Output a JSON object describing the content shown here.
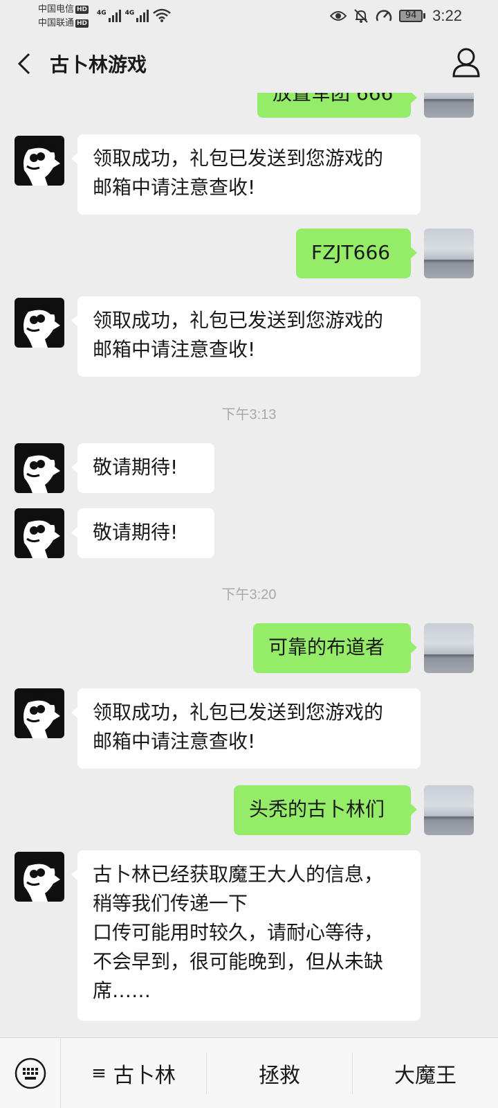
{
  "status_bar": {
    "carrier1": "中国电信",
    "carrier2": "中国联通",
    "hd": "HD",
    "network": "4G",
    "battery": "94",
    "time": "3:22"
  },
  "header": {
    "title": "古卜林游戏"
  },
  "chat": {
    "partial_top": "放置军团 666",
    "reply_gift": "领取成功，礼包已发送到您游戏的\n邮箱中请注意查收!",
    "code1": "FZJT666",
    "time1": "下午3:13",
    "wait": "敬请期待!",
    "time2": "下午3:20",
    "code2": "可靠的布道者",
    "code3": "头秃的古卜林们",
    "long_reply": "古卜林已经获取魔王大人的信息，\n稍等我们传递一下\n口传可能用时较久，请耐心等待，\n不会早到，很可能晚到，但从未缺\n席……"
  },
  "menu": {
    "item1_glyph": "≡",
    "item1": "古卜林",
    "item2": "拯救",
    "item3": "大魔王"
  }
}
